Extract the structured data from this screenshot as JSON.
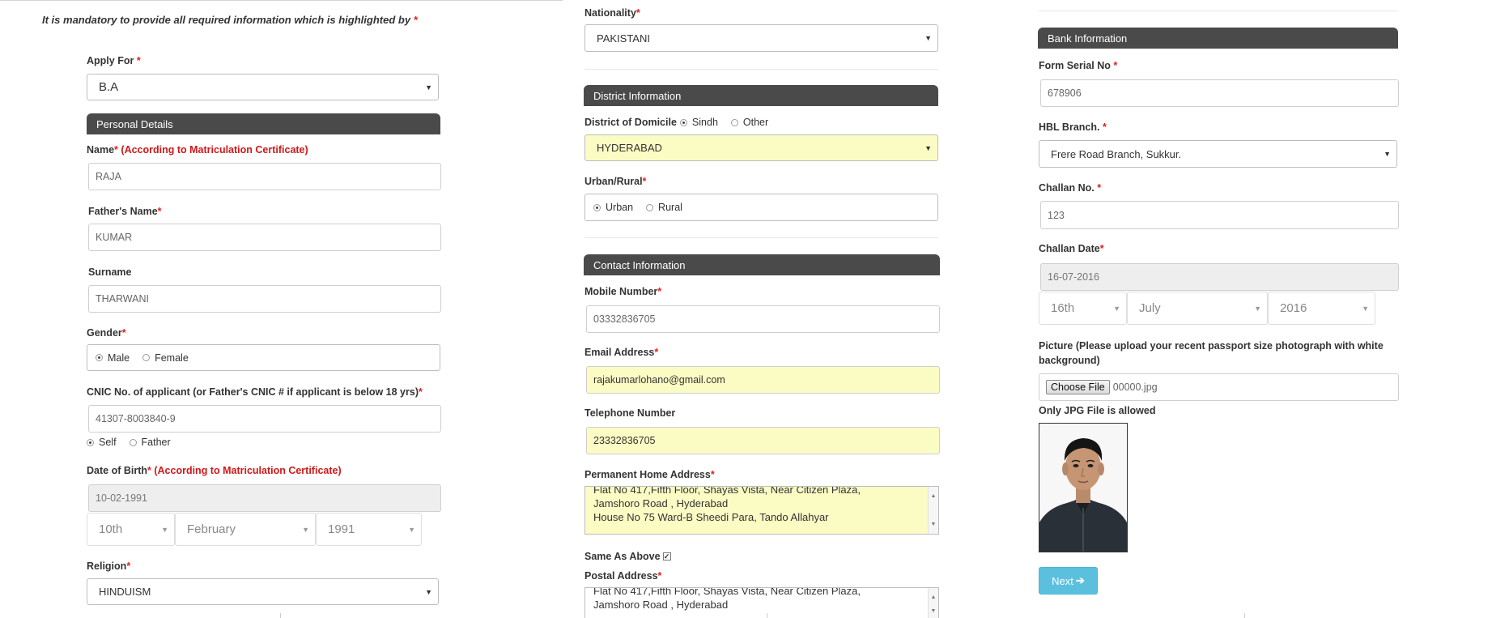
{
  "notice": {
    "text": "It is mandatory to provide all required information which is highlighted by",
    "star": "*"
  },
  "col1": {
    "apply_for": {
      "label": "Apply For",
      "value": "B.A"
    },
    "personal_header": "Personal Details",
    "name": {
      "label": "Name",
      "note": "(According to Matriculation Certificate)",
      "value": "RAJA"
    },
    "father_name": {
      "label": "Father's Name",
      "value": "KUMAR"
    },
    "surname": {
      "label": "Surname",
      "value": "THARWANI"
    },
    "gender": {
      "label": "Gender",
      "options": [
        "Male",
        "Female"
      ],
      "selected": "Male"
    },
    "cnic": {
      "label": "CNIC No. of applicant (or Father's CNIC # if applicant is below 18 yrs)",
      "value": "41307-8003840-9",
      "options": [
        "Self",
        "Father"
      ],
      "selected": "Self"
    },
    "dob": {
      "label": "Date of Birth",
      "note": "(According to Matriculation Certificate)",
      "value": "10-02-1991",
      "day": "10th",
      "month": "February",
      "year": "1991"
    },
    "religion": {
      "label": "Religion",
      "value": "HINDUISM"
    }
  },
  "col2": {
    "nationality": {
      "label": "Nationality",
      "value": "PAKISTANI"
    },
    "district_header": "District Information",
    "domicile": {
      "label": "District of Domicile",
      "options": [
        "Sindh",
        "Other"
      ],
      "selected": "Sindh",
      "value": "HYDERABAD"
    },
    "urban_rural": {
      "label": "Urban/Rural",
      "options": [
        "Urban",
        "Rural"
      ],
      "selected": "Urban"
    },
    "contact_header": "Contact Information",
    "mobile": {
      "label": "Mobile Number",
      "value": "03332836705"
    },
    "email": {
      "label": "Email Address",
      "value": "rajakumarlohano@gmail.com"
    },
    "telephone": {
      "label": "Telephone Number",
      "value": "23332836705"
    },
    "permanent_address": {
      "label": "Permanent Home Address",
      "line1": "Flat No 417,Fifth Floor,  Shayas Vista, Near Citizen Plaza,",
      "line2": "Jamshoro Road , Hyderabad",
      "line3": "House No 75 Ward-B Sheedi Para, Tando Allahyar"
    },
    "same_as_above": {
      "label": "Same As Above",
      "checked": true
    },
    "postal_address": {
      "label": "Postal Address",
      "line1": "Flat No 417,Fifth Floor,  Shayas Vista, Near Citizen Plaza,",
      "line2": "Jamshoro Road , Hyderabad"
    }
  },
  "col3": {
    "bank_header": "Bank Information",
    "form_serial": {
      "label": "Form Serial No",
      "value": "678906"
    },
    "hbl_branch": {
      "label": "HBL Branch.",
      "value": "Frere Road Branch, Sukkur."
    },
    "challan_no": {
      "label": "Challan No.",
      "value": "123"
    },
    "challan_date": {
      "label": "Challan Date",
      "value": "16-07-2016",
      "day": "16th",
      "month": "July",
      "year": "2016"
    },
    "picture": {
      "label": "Picture (Please upload your recent passport size photograph with white background)",
      "button": "Choose File",
      "filename": "00000.jpg",
      "note": "Only JPG File is allowed"
    },
    "next_button": "Next",
    "next_icon": "arrow-right-icon"
  },
  "colors": {
    "header_bg": "#4a4a4a",
    "highlight": "#fbfcc4",
    "required": "#e02020",
    "next_btn": "#5bc0de"
  }
}
